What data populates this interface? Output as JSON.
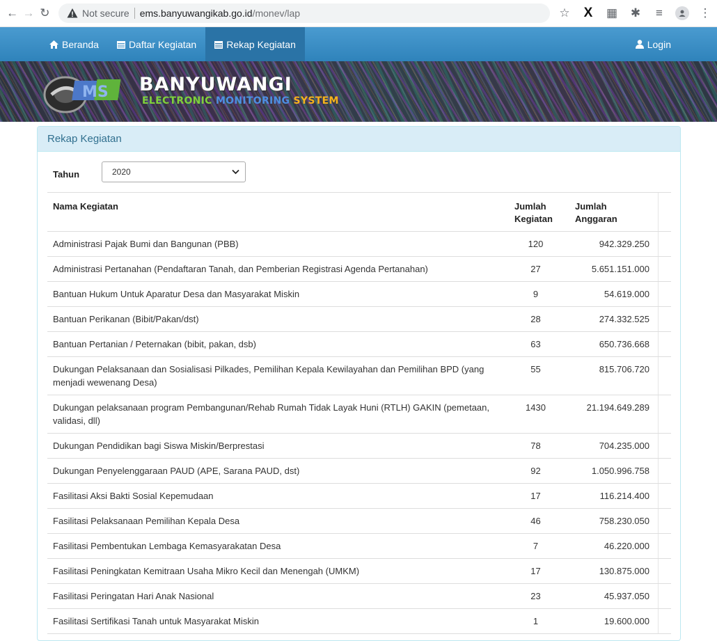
{
  "browser": {
    "security_label": "Not secure",
    "url_host": "ems.banyuwangikab.go.id",
    "url_path": "/monev/lap"
  },
  "navbar": {
    "items": [
      {
        "label": "Beranda",
        "icon": "home-icon"
      },
      {
        "label": "Daftar Kegiatan",
        "icon": "calendar-icon"
      },
      {
        "label": "Rekap Kegiatan",
        "icon": "calendar-icon"
      }
    ],
    "login_label": "Login"
  },
  "banner": {
    "title": "BANYUWANGI",
    "sub_word_1": "ELECTRONIC ",
    "sub_word_2": "MONITORING ",
    "sub_word_3": "SYSTEM",
    "logo_letters": "MS"
  },
  "panel": {
    "heading": "Rekap Kegiatan",
    "year_label": "Tahun",
    "year_value": "2020"
  },
  "table": {
    "headers": {
      "name": "Nama Kegiatan",
      "count_line1": "Jumlah",
      "count_line2": "Kegiatan",
      "budget_line1": "Jumlah",
      "budget_line2": "Anggaran"
    },
    "rows": [
      {
        "name": "Administrasi Pajak Bumi dan Bangunan (PBB)",
        "count": "120",
        "budget": "942.329.250"
      },
      {
        "name": "Administrasi Pertanahan (Pendaftaran Tanah, dan Pemberian Registrasi Agenda Pertanahan)",
        "count": "27",
        "budget": "5.651.151.000"
      },
      {
        "name": "Bantuan Hukum Untuk Aparatur Desa dan Masyarakat Miskin",
        "count": "9",
        "budget": "54.619.000"
      },
      {
        "name": "Bantuan Perikanan (Bibit/Pakan/dst)",
        "count": "28",
        "budget": "274.332.525"
      },
      {
        "name": "Bantuan Pertanian / Peternakan (bibit, pakan, dsb)",
        "count": "63",
        "budget": "650.736.668"
      },
      {
        "name": "Dukungan Pelaksanaan dan Sosialisasi Pilkades, Pemilihan Kepala Kewilayahan dan Pemilihan BPD (yang menjadi wewenang Desa)",
        "count": "55",
        "budget": "815.706.720"
      },
      {
        "name": "Dukungan pelaksanaan program Pembangunan/Rehab Rumah Tidak Layak Huni (RTLH) GAKIN (pemetaan, validasi, dll)",
        "count": "1430",
        "budget": "21.194.649.289"
      },
      {
        "name": "Dukungan Pendidikan bagi Siswa Miskin/Berprestasi",
        "count": "78",
        "budget": "704.235.000"
      },
      {
        "name": "Dukungan Penyelenggaraan PAUD (APE, Sarana PAUD, dst)",
        "count": "92",
        "budget": "1.050.996.758"
      },
      {
        "name": "Fasilitasi Aksi Bakti Sosial Kepemudaan",
        "count": "17",
        "budget": "116.214.400"
      },
      {
        "name": "Fasilitasi Pelaksanaan Pemilihan Kepala Desa",
        "count": "46",
        "budget": "758.230.050"
      },
      {
        "name": "Fasilitasi Pembentukan Lembaga Kemasyarakatan Desa",
        "count": "7",
        "budget": "46.220.000"
      },
      {
        "name": "Fasilitasi Peningkatan Kemitraan Usaha Mikro Kecil dan Menengah (UMKM)",
        "count": "17",
        "budget": "130.875.000"
      },
      {
        "name": "Fasilitasi Peringatan Hari Anak Nasional",
        "count": "23",
        "budget": "45.937.050"
      },
      {
        "name": "Fasilitasi Sertifikasi Tanah untuk Masyarakat Miskin",
        "count": "1",
        "budget": "19.600.000"
      }
    ]
  },
  "colors": {
    "navbar": "#3c8fc4",
    "navbar_active": "#2a73a6",
    "panel_heading_bg": "#d9edf7",
    "panel_heading_text": "#31708f"
  }
}
